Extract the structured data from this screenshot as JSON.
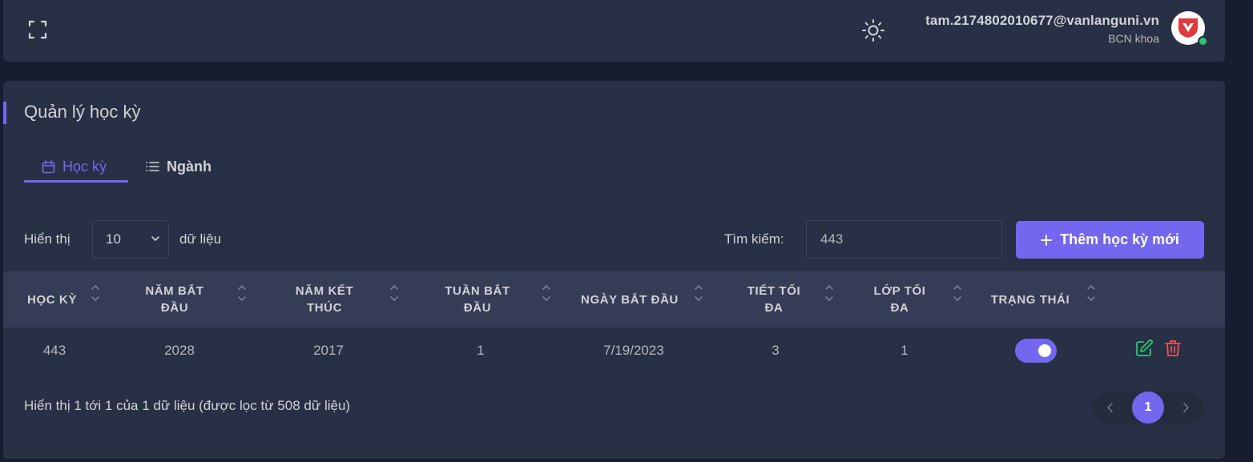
{
  "header": {
    "user_email": "tam.2174802010677@vanlanguni.vn",
    "user_role": "BCN khoa",
    "icons": [
      "fullscreen-icon",
      "sun-icon",
      "avatar-logo"
    ]
  },
  "page": {
    "title": "Quản lý học kỳ"
  },
  "tabs": [
    {
      "label": "Học kỳ",
      "icon": "calendar-icon",
      "active": true
    },
    {
      "label": "Ngành",
      "icon": "list-icon",
      "active": false
    }
  ],
  "controls": {
    "show_label": "Hiển thị",
    "page_size": "10",
    "data_label": "dữ liệu",
    "search_label": "Tìm kiếm:",
    "search_value": "443",
    "add_button": "Thêm học kỳ mới"
  },
  "table": {
    "headers": [
      "HỌC KỲ",
      "NĂM BẮT ĐẦU",
      "NĂM KẾT THÚC",
      "TUẦN BẮT ĐẦU",
      "NGÀY BẮT ĐẦU",
      "TIẾT TỐI ĐA",
      "LỚP TỐI ĐA",
      "TRẠNG THÁI"
    ],
    "rows": [
      {
        "cells": [
          "443",
          "2028",
          "2017",
          "1",
          "7/19/2023",
          "3",
          "1"
        ],
        "status_on": true
      }
    ]
  },
  "footer": {
    "info": "Hiển thị 1 tới 1 của 1 dữ liệu (được lọc từ 508 dữ liệu)",
    "current_page": "1"
  },
  "colors": {
    "accent": "#7367f0",
    "edit": "#28c76f",
    "delete": "#ea5455",
    "background": "#161d31",
    "card": "#283046"
  }
}
